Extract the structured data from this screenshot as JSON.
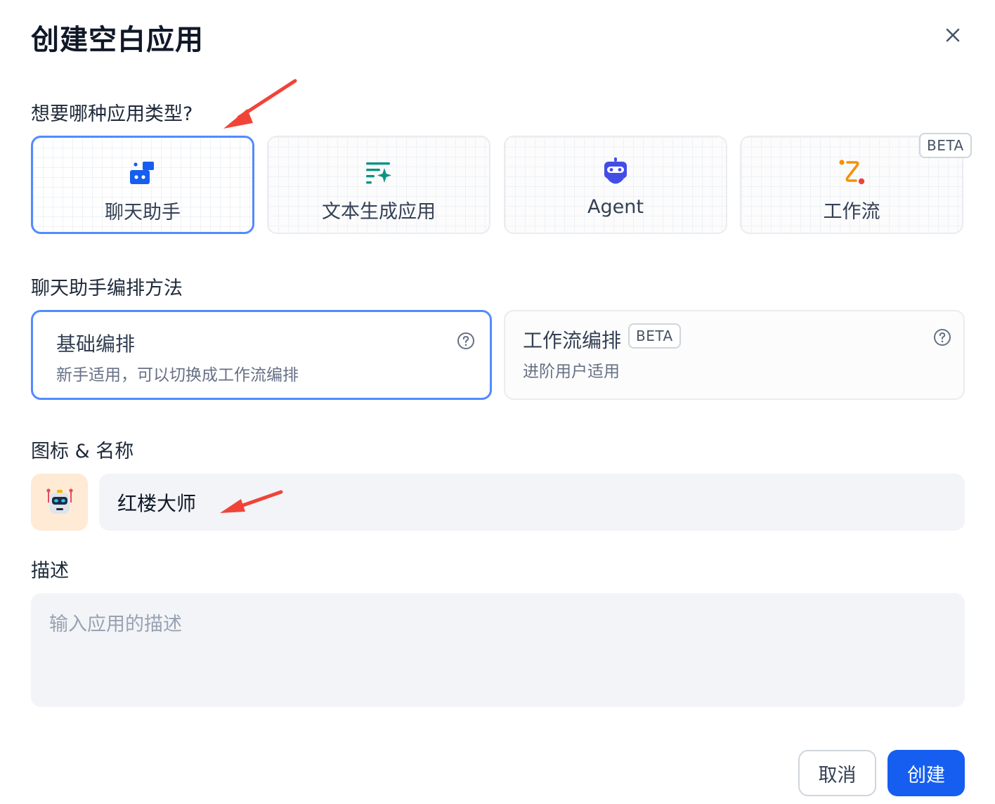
{
  "dialog": {
    "title": "创建空白应用"
  },
  "app_type": {
    "question": "想要哪种应用类型?",
    "selected": "聊天助手",
    "options": [
      {
        "label": "聊天助手",
        "icon": "chat-bot-icon",
        "color": "#155eef"
      },
      {
        "label": "文本生成应用",
        "icon": "text-generation-icon",
        "color": "#0e9384"
      },
      {
        "label": "Agent",
        "icon": "robot-icon",
        "color": "#444ce7"
      },
      {
        "label": "工作流",
        "icon": "workflow-icon",
        "color": "#f79009",
        "badge": "BETA"
      }
    ]
  },
  "orchestration": {
    "label": "聊天助手编排方法",
    "selected": "基础编排",
    "options": [
      {
        "title": "基础编排",
        "description": "新手适用，可以切换成工作流编排"
      },
      {
        "title": "工作流编排",
        "badge": "BETA",
        "description": "进阶用户适用"
      }
    ]
  },
  "icon_name": {
    "label": "图标 & 名称",
    "icon": "robot-emoji-icon",
    "name_value": "红楼大师"
  },
  "description": {
    "label": "描述",
    "placeholder": "输入应用的描述",
    "value": ""
  },
  "actions": {
    "cancel_label": "取消",
    "create_label": "创建"
  },
  "colors": {
    "accent": "#155eef",
    "selected_border": "#528bff",
    "annotation_arrow": "#f04438"
  }
}
